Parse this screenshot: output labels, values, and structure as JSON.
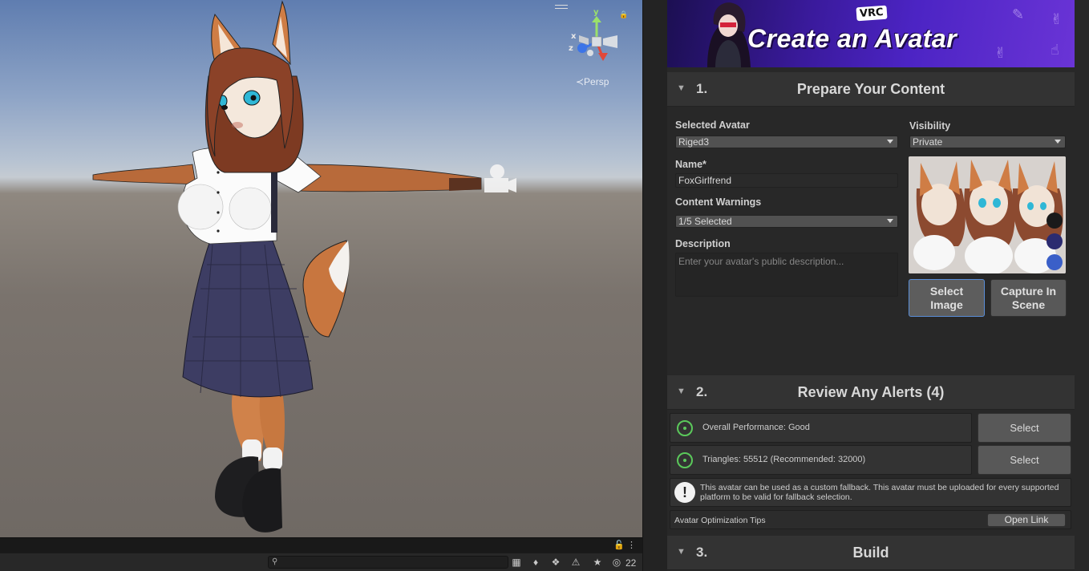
{
  "scene": {
    "persp_label": "≺Persp",
    "gizmo_axes": {
      "y": "y",
      "x": "x",
      "z": "z"
    },
    "hidden_count": "22",
    "search_placeholder": "",
    "lock_icon": "lock-icon"
  },
  "banner": {
    "title": "Create an Avatar",
    "badge": "VRC"
  },
  "sections": {
    "prepare": {
      "number": "1.",
      "title": "Prepare Your Content"
    },
    "alerts": {
      "number": "2.",
      "title": "Review Any Alerts (4)"
    },
    "build": {
      "number": "3.",
      "title": "Build"
    }
  },
  "form": {
    "selected_avatar_label": "Selected Avatar",
    "selected_avatar_value": "Riged3",
    "visibility_label": "Visibility",
    "visibility_value": "Private",
    "name_label": "Name*",
    "name_value": "FoxGirlfrend",
    "content_warnings_label": "Content Warnings",
    "content_warnings_value": "1/5 Selected",
    "description_label": "Description",
    "description_placeholder": "Enter your avatar's public description..."
  },
  "buttons": {
    "select_image": "Select\nImage",
    "capture_in_scene": "Capture In\nScene",
    "select": "Select",
    "open_link": "Open Link"
  },
  "alerts": [
    {
      "text": "Overall Performance: Good"
    },
    {
      "text": "Triangles: 55512 (Recommended: 32000)"
    }
  ],
  "info_text": "This avatar can be used as a custom fallback. This avatar must be uploaded for every supported platform to be valid for fallback selection.",
  "tips_label": "Avatar Optimization Tips",
  "colors": {
    "ok_green": "#5bc95b",
    "banner_purple": "#4c24c4",
    "panel_bg": "#282828"
  }
}
